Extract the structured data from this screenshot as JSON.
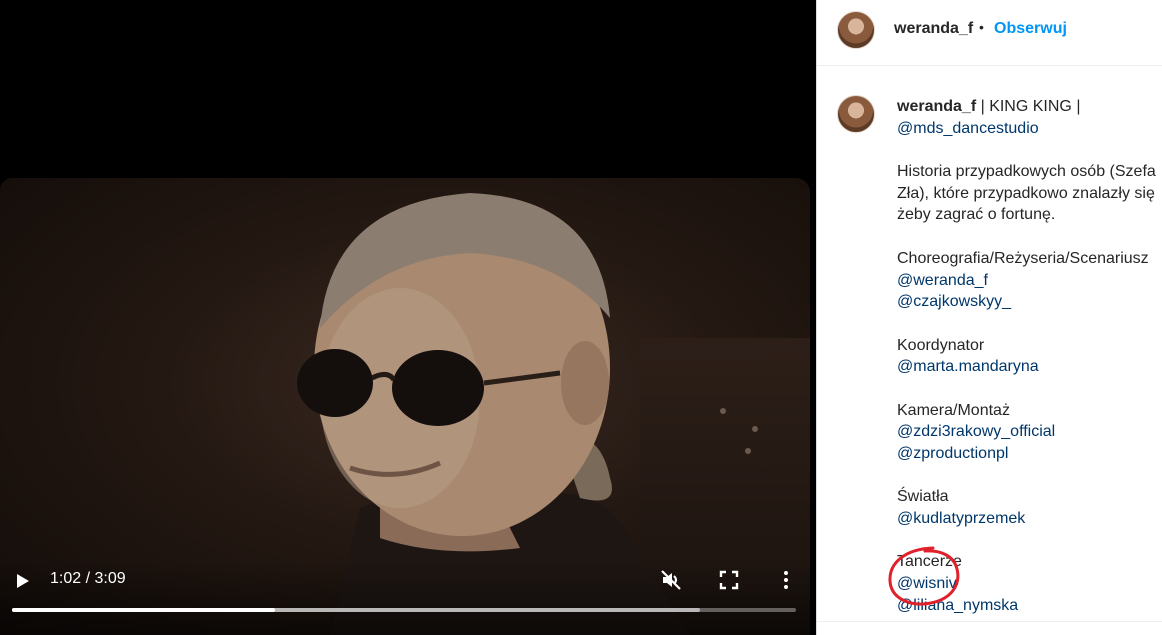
{
  "video": {
    "time_display": "1:02 / 3:09",
    "played_fraction": 0.335,
    "buffered_fraction": 0.877
  },
  "post": {
    "username": "weranda_f",
    "separator": "•",
    "follow_label": "Obserwuj"
  },
  "caption": {
    "username": "weranda_f",
    "title_rest": " | KING KING |",
    "title_mention": "@mds_dancestudio",
    "desc_1": "Historia przypadkowych osób (Szefa",
    "desc_2": "Zła), które przypadkowo znalazły się",
    "desc_3": "żeby zagrać o fortunę.",
    "sec_choreo": "Choreografia/Reżyseria/Scenariusz",
    "m_weranda": "@weranda_f",
    "m_czajkowskyy": "@czajkowskyy_",
    "sec_coord": "Koordynator",
    "m_marta": "@marta.mandaryna",
    "sec_camera": "Kamera/Montaż",
    "m_zdzi": "@zdzi3rakowy_official",
    "m_zprod": "@zproductionpl",
    "sec_lights": "Światła",
    "m_kudlaty": "@kudlatyprzemek",
    "sec_dancers": "Tancerze",
    "m_wisniv": "@wisniv",
    "m_liliana": "@liliana_nymska"
  },
  "colors": {
    "follow": "#0095f6",
    "mention": "#00376b",
    "annotation": "#e0202a"
  },
  "icons": [
    "play-icon",
    "mute-icon",
    "fullscreen-icon",
    "more-vertical-icon"
  ]
}
